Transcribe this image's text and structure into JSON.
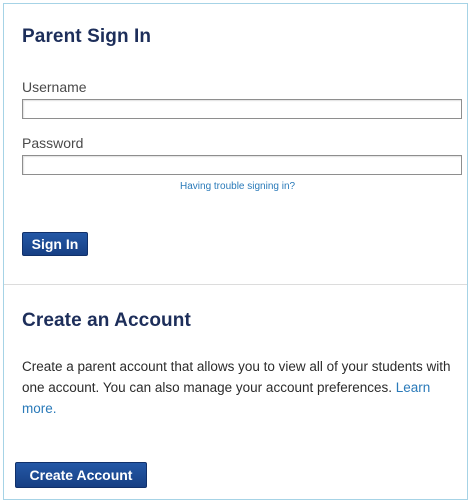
{
  "signin": {
    "heading": "Parent Sign In",
    "username_label": "Username",
    "username_value": "",
    "password_label": "Password",
    "password_value": "",
    "trouble_link": "Having trouble signing in?",
    "signin_button": "Sign In"
  },
  "create": {
    "heading": "Create an Account",
    "description": "Create a parent account that allows you to view all of your students with one account. You can also manage your account preferences.",
    "learn_more": "Learn more.",
    "create_button": "Create Account"
  },
  "colors": {
    "heading": "#1d2e5a",
    "link": "#2a7ab9",
    "button": "#1f4e9a",
    "frame_border": "#a6d3e6"
  }
}
